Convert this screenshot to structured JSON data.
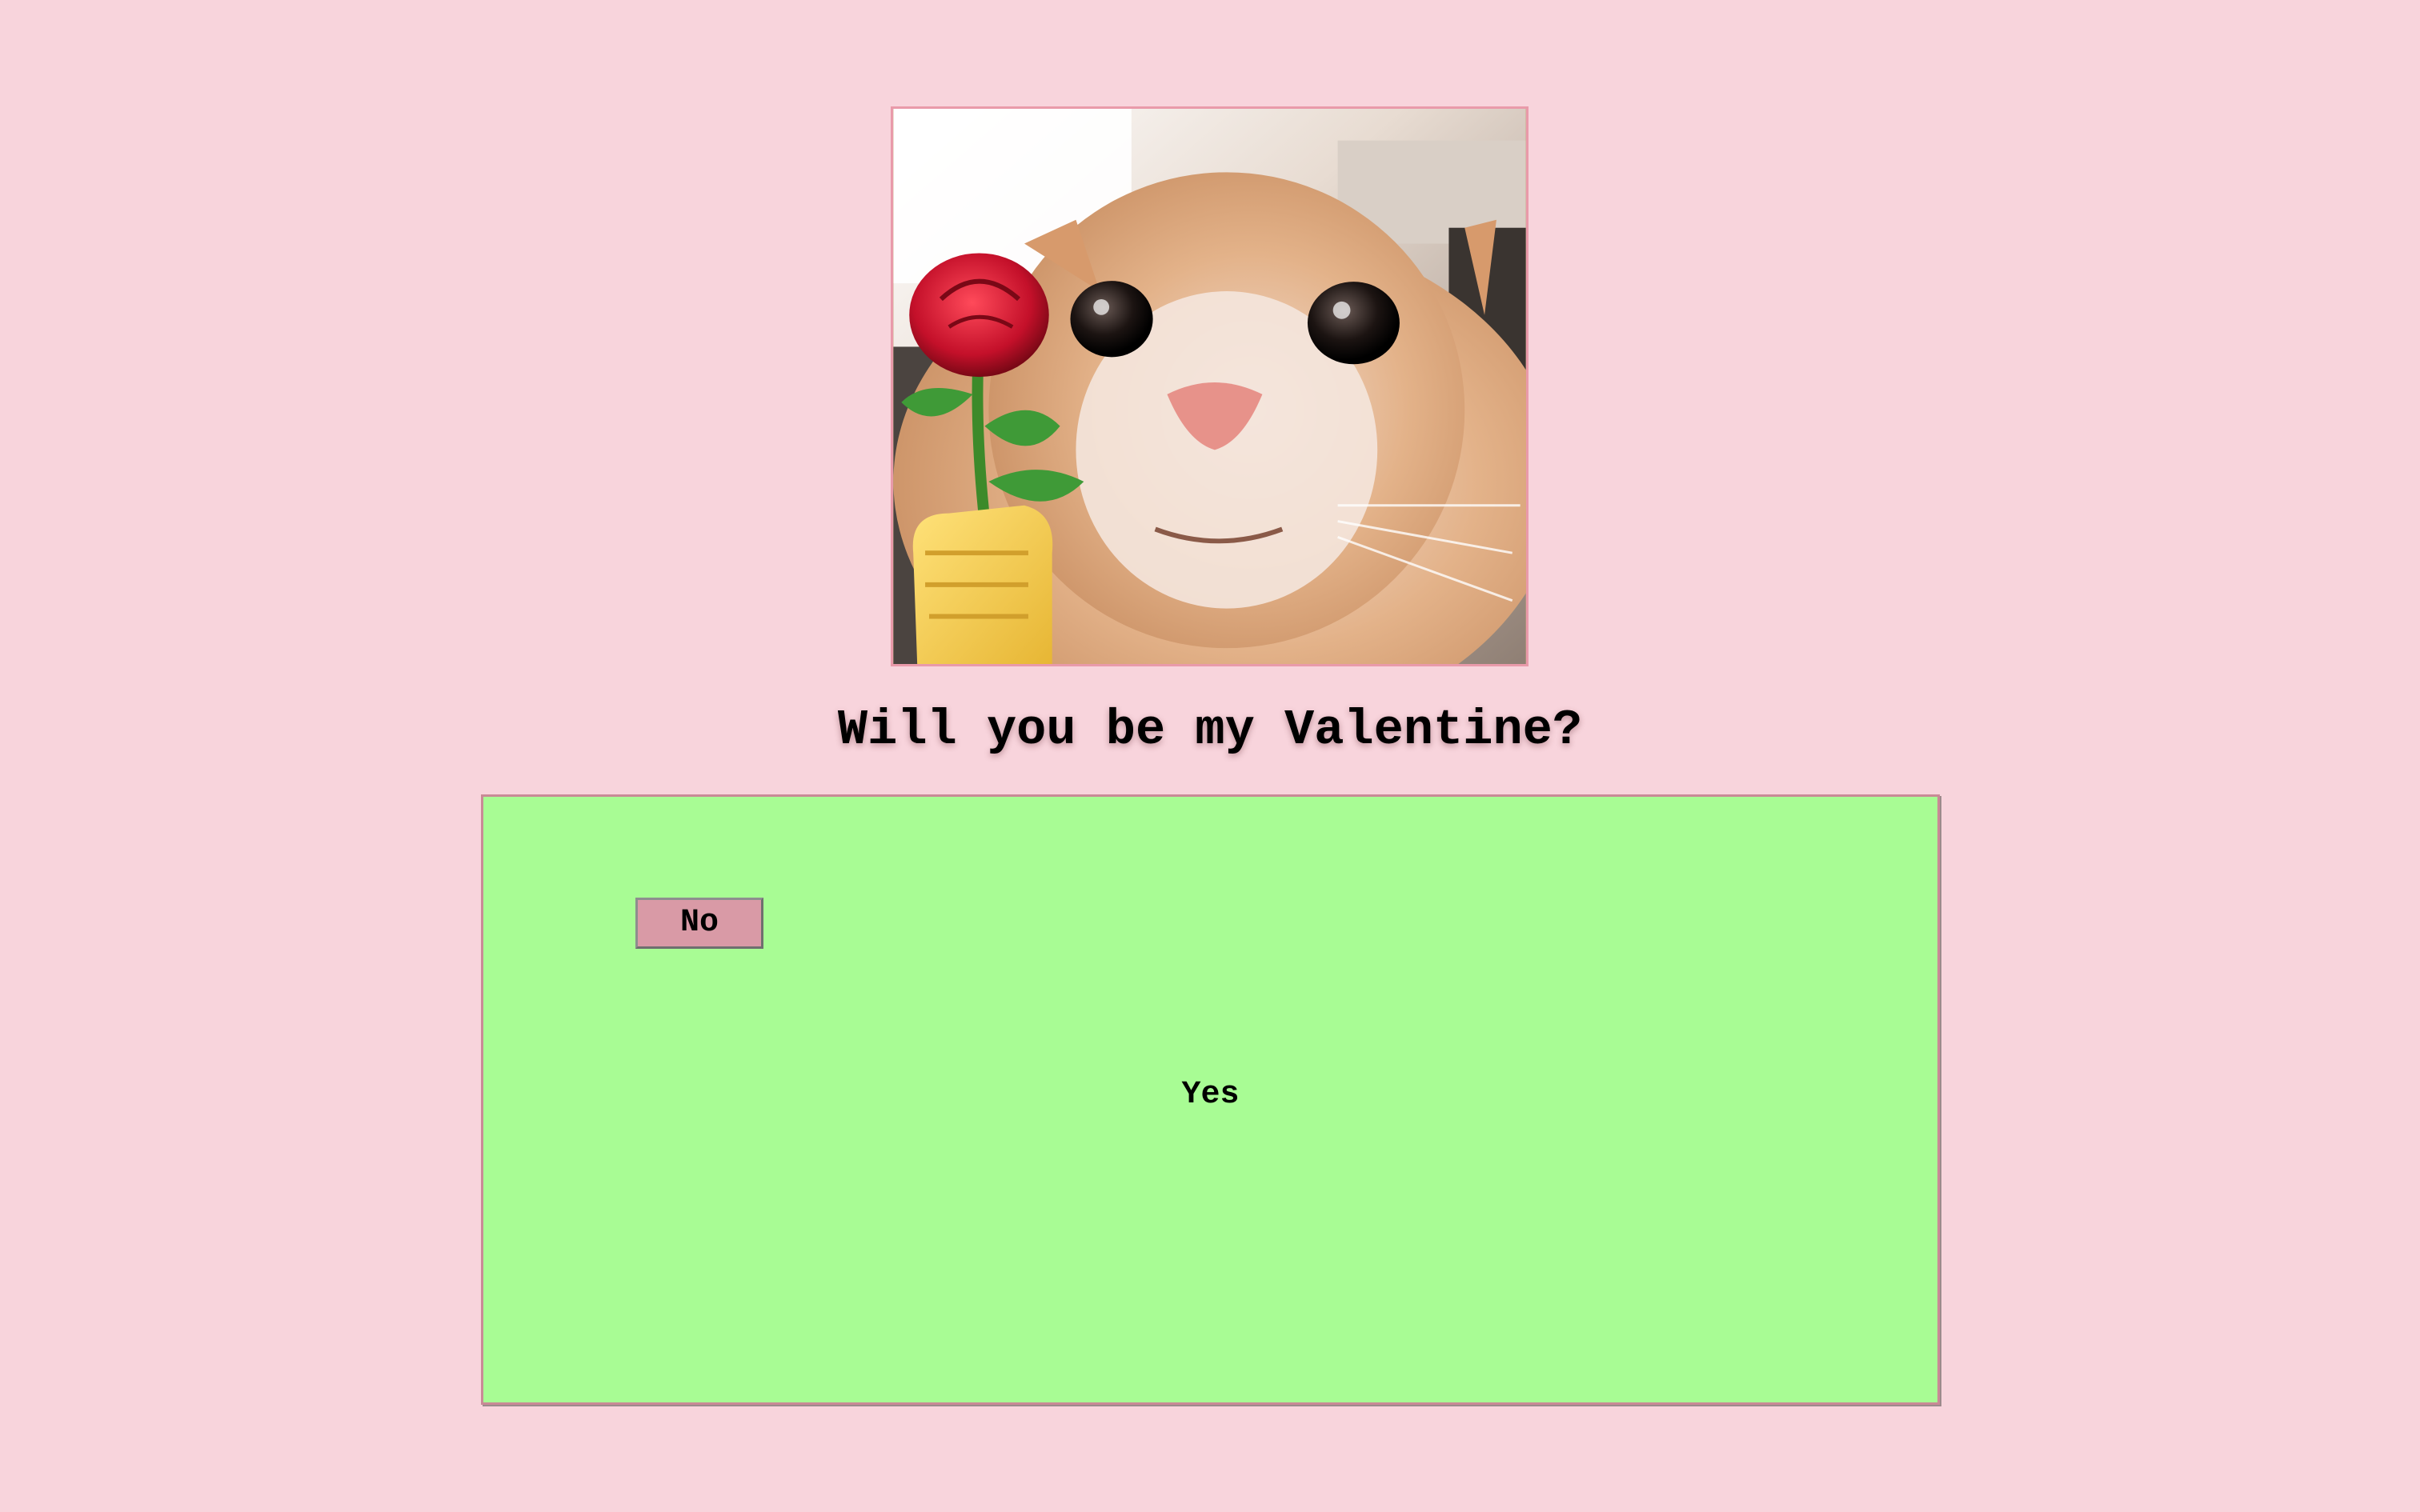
{
  "main": {
    "image_alt": "Cat holding a red rose",
    "question": "Will you be my Valentine?"
  },
  "answers": {
    "no_label": "No",
    "yes_label": "Yes"
  },
  "colors": {
    "page_background": "#f8d4dc",
    "answer_area_background": "#a8fc94",
    "no_button_background": "#d99aa6",
    "frame_border": "#e99aaa"
  }
}
